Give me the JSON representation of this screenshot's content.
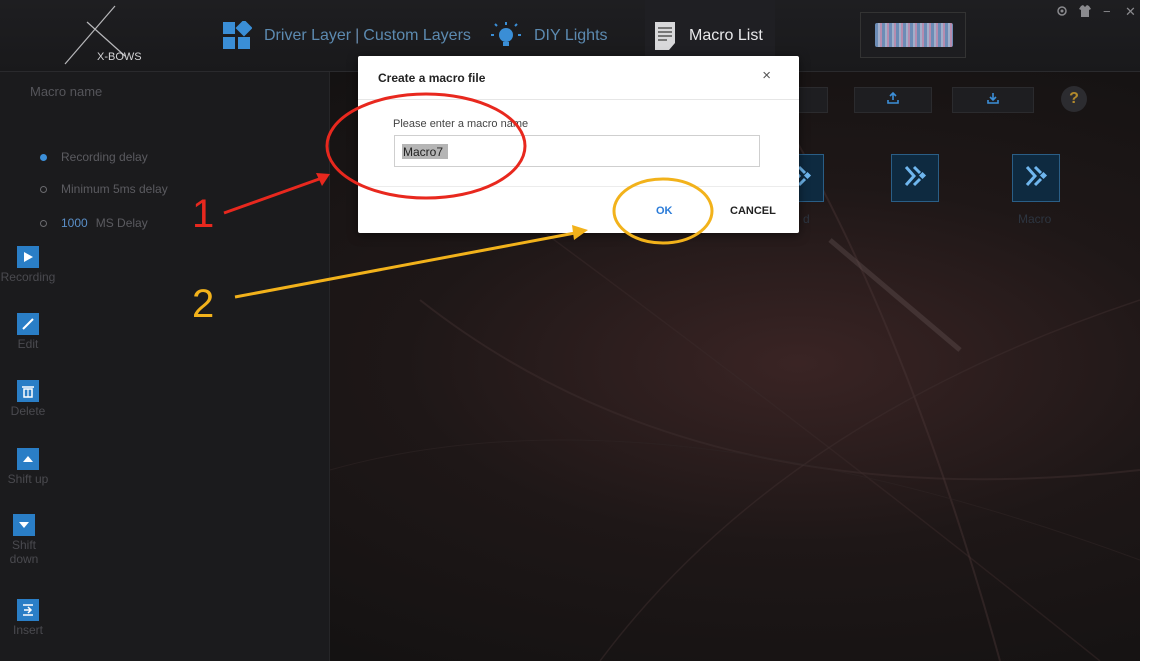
{
  "header": {
    "logo_text": "X-BOWS",
    "nav_driver_label": "Driver Layer",
    "nav_custom_label": "Custom Layers",
    "nav_separator": "|",
    "nav_diy_label": "DIY Lights",
    "nav_macro_label": "Macro List",
    "window_minimize": "−",
    "window_close": "✕"
  },
  "sidebar": {
    "macro_name_label": "Macro name",
    "options": [
      {
        "label": "Recording delay",
        "selected": true
      },
      {
        "label": "Minimum 5ms delay",
        "selected": false
      },
      {
        "label": "MS Delay",
        "value": "1000",
        "selected": false
      }
    ],
    "tools": [
      {
        "label": "Recording",
        "icon": "play-icon"
      },
      {
        "label": "Edit",
        "icon": "pencil-icon"
      },
      {
        "label": "Delete",
        "icon": "trash-icon"
      },
      {
        "label": "Shift up",
        "icon": "arrow-up-icon"
      },
      {
        "label": "Shift down",
        "icon": "arrow-down-icon"
      },
      {
        "label": "Insert",
        "icon": "insert-icon"
      }
    ]
  },
  "main": {
    "help_label": "?",
    "macro_tiles": [
      {
        "label": "d"
      },
      {
        "label": ""
      },
      {
        "label": "Macro"
      }
    ]
  },
  "modal": {
    "title": "Create a macro file",
    "close_label": "×",
    "prompt": "Please enter a macro name",
    "input_value": "Macro7",
    "ok_label": "OK",
    "cancel_label": "CANCEL"
  },
  "annotations": {
    "step1": "1",
    "step2": "2",
    "red": "#e8281e",
    "yellow": "#f2b21b"
  },
  "colors": {
    "accent_blue": "#2a7ec6",
    "nav_blue": "#5c8ab0",
    "background": "#161414"
  }
}
